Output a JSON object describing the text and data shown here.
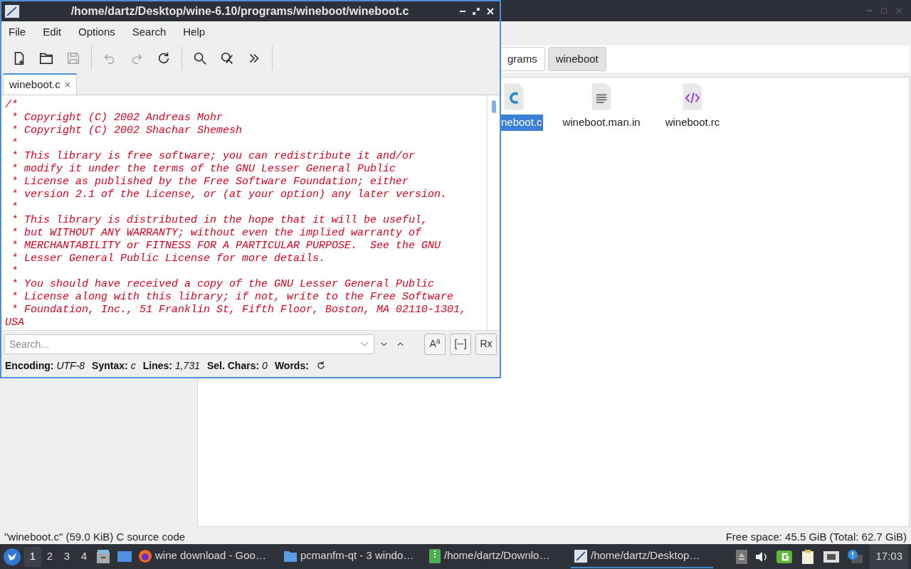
{
  "editor": {
    "title": "/home/dartz/Desktop/wine-6.10/programs/wineboot/wineboot.c",
    "menu": [
      "File",
      "Edit",
      "Options",
      "Search",
      "Help"
    ],
    "toolbar": [
      {
        "kind": "new",
        "disabled": false
      },
      {
        "kind": "open",
        "disabled": false
      },
      {
        "kind": "save",
        "disabled": true
      },
      {
        "kind": "sep"
      },
      {
        "kind": "undo",
        "disabled": true
      },
      {
        "kind": "redo",
        "disabled": true
      },
      {
        "kind": "reload",
        "disabled": false
      },
      {
        "kind": "sep"
      },
      {
        "kind": "find",
        "disabled": false
      },
      {
        "kind": "replace",
        "disabled": false
      },
      {
        "kind": "more",
        "disabled": false
      },
      {
        "kind": "sep"
      }
    ],
    "tabs": [
      {
        "label": "wineboot.c",
        "selected": true,
        "close": "×"
      }
    ],
    "code": [
      "/*",
      " * Copyright (C) 2002 Andreas Mohr",
      " * Copyright (C) 2002 Shachar Shemesh",
      " *",
      " * This library is free software; you can redistribute it and/or",
      " * modify it under the terms of the GNU Lesser General Public",
      " * License as published by the Free Software Foundation; either",
      " * version 2.1 of the License, or (at your option) any later version.",
      " *",
      " * This library is distributed in the hope that it will be useful,",
      " * but WITHOUT ANY WARRANTY; without even the implied warranty of",
      " * MERCHANTABILITY or FITNESS FOR A PARTICULAR PURPOSE.  See the GNU",
      " * Lesser General Public License for more details.",
      " *",
      " * You should have received a copy of the GNU Lesser General Public",
      " * License along with this library; if not, write to the Free Software",
      " * Foundation, Inc., 51 Franklin St, Fifth Floor, Boston, MA 02110-1301,",
      "USA"
    ],
    "search": {
      "placeholder": "Search..."
    },
    "search_options": [
      {
        "label": "A",
        "sup": "a",
        "selected": false
      },
      {
        "label": "[--]",
        "selected": false
      },
      {
        "label": "Rx",
        "selected": false
      }
    ],
    "status": [
      {
        "key": "Encoding:",
        "value": "UTF-8"
      },
      {
        "key": "Syntax:",
        "value": "c"
      },
      {
        "key": "Lines:",
        "value": "1,731"
      },
      {
        "key": "Sel. Chars:",
        "value": "0"
      },
      {
        "key": "Words:"
      }
    ]
  },
  "file_manager": {
    "path": [
      {
        "label": "grams",
        "selected": false
      },
      {
        "label": "wineboot",
        "selected": true
      }
    ],
    "files": [
      {
        "name": "neboot.c",
        "kind": "c",
        "selected": true
      },
      {
        "name": "wineboot.man.in",
        "kind": "text",
        "selected": false
      },
      {
        "name": "wineboot.rc",
        "kind": "code",
        "selected": false
      }
    ],
    "status_left": "\"wineboot.c\" (59.0 KiB) C source code",
    "status_right": "Free space: 45.5 GiB (Total: 62.7 GiB)"
  },
  "taskbar": {
    "desktops": [
      {
        "label": "1",
        "selected": true
      },
      {
        "label": "2",
        "selected": false
      },
      {
        "label": "3",
        "selected": false
      },
      {
        "label": "4",
        "selected": false
      }
    ],
    "tasks": [
      {
        "label": "wine download - Goo…",
        "kind": "browser",
        "selected": false
      },
      {
        "label": "pcmanfm-qt - 3 windo…",
        "kind": "folder",
        "selected": false
      },
      {
        "label": "/home/dartz/Downlo…",
        "kind": "archive",
        "selected": false
      },
      {
        "label": "/home/dartz/Desktop…",
        "kind": "editor",
        "selected": true
      }
    ],
    "clock": "17:03"
  }
}
